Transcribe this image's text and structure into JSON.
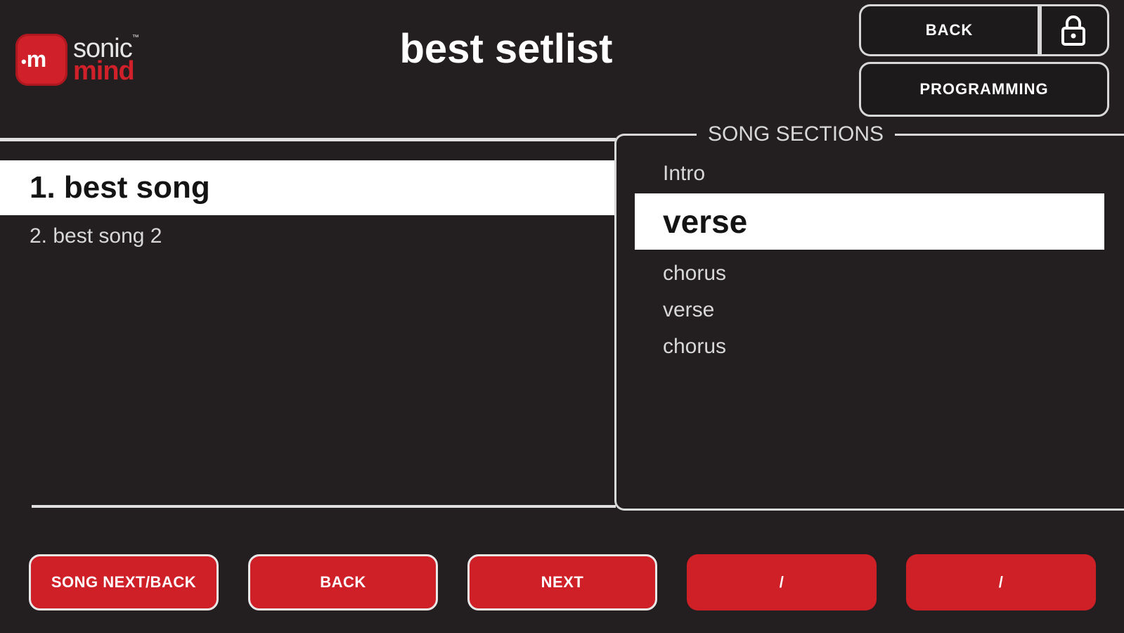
{
  "logo": {
    "badge_text": "m",
    "word_top": "sonic",
    "word_bottom": "mind",
    "mark": "™"
  },
  "header": {
    "title": "best setlist",
    "back_label": "BACK",
    "lock_icon": "lock-icon",
    "programming_label": "PROGRAMMING"
  },
  "songs": {
    "items": [
      {
        "label": "1. best song",
        "active": true
      },
      {
        "label": "2. best song 2",
        "active": false
      }
    ]
  },
  "sections": {
    "heading": "SONG SECTIONS",
    "items": [
      {
        "label": "Intro",
        "active": false
      },
      {
        "label": "verse",
        "active": true
      },
      {
        "label": "chorus",
        "active": false
      },
      {
        "label": "verse",
        "active": false
      },
      {
        "label": "chorus",
        "active": false
      }
    ]
  },
  "bottom_buttons": {
    "song_next_back": "SONG NEXT/BACK",
    "back": "BACK",
    "next": "NEXT",
    "slot4": "/",
    "slot5": "/"
  },
  "colors": {
    "background": "#231f20",
    "accent_red": "#cf2028",
    "outline": "#d8d8d8",
    "highlight": "#ffffff"
  }
}
